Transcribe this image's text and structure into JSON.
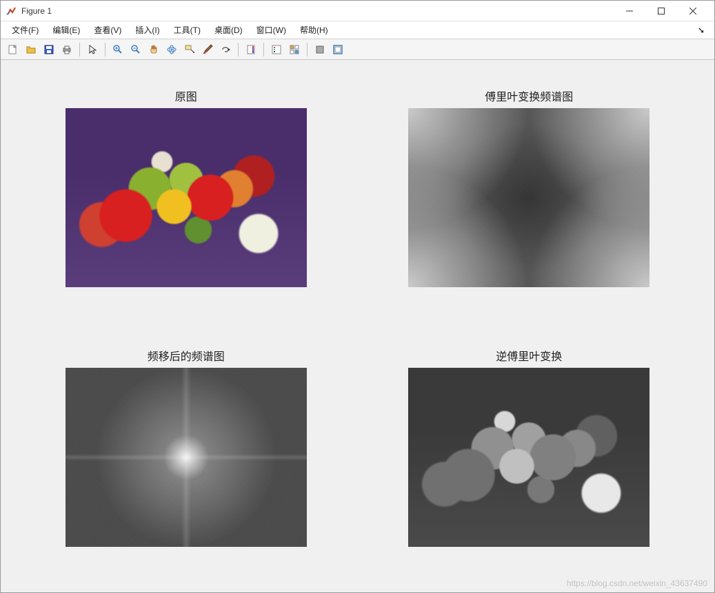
{
  "window": {
    "title": "Figure 1"
  },
  "menu": {
    "file": "文件(F)",
    "edit": "编辑(E)",
    "view": "查看(V)",
    "insert": "插入(I)",
    "tools": "工具(T)",
    "desktop": "桌面(D)",
    "window": "窗口(W)",
    "help": "帮助(H)"
  },
  "subplots": {
    "p1": {
      "title": "原图"
    },
    "p2": {
      "title": "傅里叶变换频谱图"
    },
    "p3": {
      "title": "频移后的频谱图"
    },
    "p4": {
      "title": "逆傅里叶变换"
    }
  },
  "watermark": "https://blog.csdn.net/weixin_43637490"
}
